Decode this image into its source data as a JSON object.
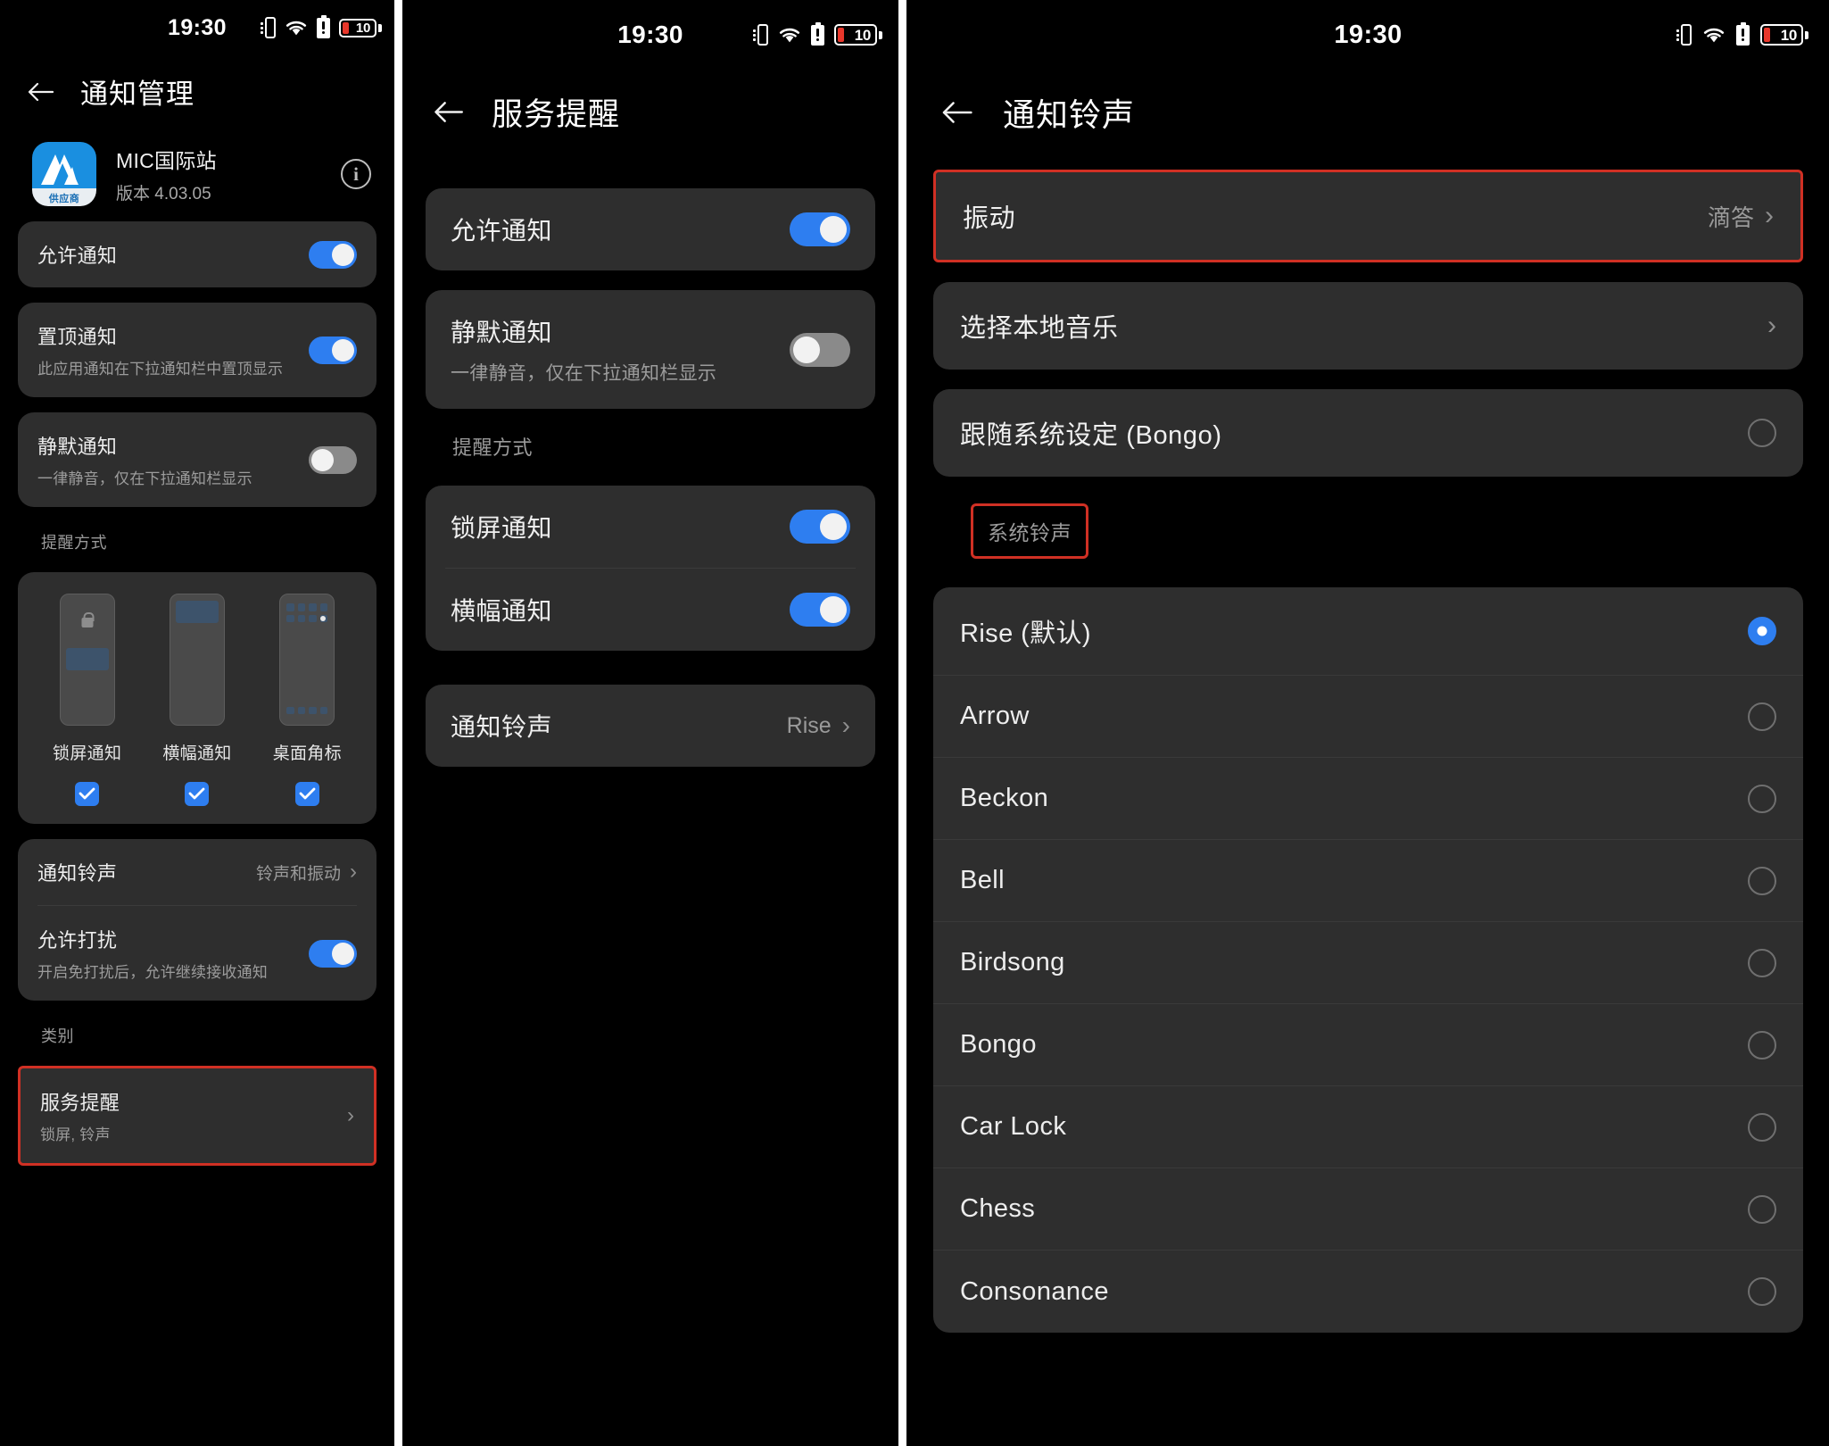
{
  "statusbar": {
    "time": "19:30",
    "battery_level": "10",
    "icons": [
      "vibrate-icon",
      "wifi-icon",
      "battery-alert-icon",
      "battery-icon"
    ]
  },
  "colors": {
    "accent_blue": "#2e7ef0",
    "card_bg": "#2e2e2e",
    "screen_bg": "#000000",
    "highlight_red": "#d03024",
    "battery_red": "#e8372b"
  },
  "panel1": {
    "title": "通知管理",
    "back_icon": "back-arrow-icon",
    "app": {
      "name": "MIC国际站",
      "version": "版本 4.03.05",
      "icon_badge": "供应商",
      "info_icon": "info-icon"
    },
    "rows": [
      {
        "title": "允许通知",
        "sub": "",
        "toggle": "on"
      },
      {
        "title": "置顶通知",
        "sub": "此应用通知在下拉通知栏中置顶显示",
        "toggle": "on"
      },
      {
        "title": "静默通知",
        "sub": "一律静音，仅在下拉通知栏显示",
        "toggle": "off"
      }
    ],
    "section_style_label": "提醒方式",
    "styles": [
      {
        "label": "锁屏通知",
        "checked": true,
        "preview": "lockscreen"
      },
      {
        "label": "横幅通知",
        "checked": true,
        "preview": "banner"
      },
      {
        "label": "桌面角标",
        "checked": true,
        "preview": "badge"
      }
    ],
    "ringtone_row": {
      "title": "通知铃声",
      "value": "铃声和振动"
    },
    "disturb_row": {
      "title": "允许打扰",
      "sub": "开启免打扰后，允许继续接收通知",
      "toggle": "on"
    },
    "section_category_label": "类别",
    "category_row": {
      "title": "服务提醒",
      "sub": "锁屏, 铃声",
      "highlighted": true
    }
  },
  "panel2": {
    "title": "服务提醒",
    "back_icon": "back-arrow-icon",
    "rows": [
      {
        "title": "允许通知",
        "sub": "",
        "toggle": "on"
      },
      {
        "title": "静默通知",
        "sub": "一律静音，仅在下拉通知栏显示",
        "toggle": "off"
      }
    ],
    "section_label": "提醒方式",
    "alert_rows": [
      {
        "title": "锁屏通知",
        "toggle": "on"
      },
      {
        "title": "横幅通知",
        "toggle": "on"
      }
    ],
    "ringtone_row": {
      "title": "通知铃声",
      "value": "Rise"
    }
  },
  "panel3": {
    "title": "通知铃声",
    "back_icon": "back-arrow-icon",
    "vibration_row": {
      "title": "振动",
      "value": "滴答",
      "highlighted": true
    },
    "local_music_row": {
      "title": "选择本地音乐"
    },
    "follow_system_row": {
      "title": "跟随系统设定 (Bongo)",
      "selected": false
    },
    "system_tones_label": "系统铃声",
    "system_tones_label_highlighted": true,
    "tones": [
      {
        "label": "Rise (默认)",
        "selected": true
      },
      {
        "label": "Arrow",
        "selected": false
      },
      {
        "label": "Beckon",
        "selected": false
      },
      {
        "label": "Bell",
        "selected": false
      },
      {
        "label": "Birdsong",
        "selected": false
      },
      {
        "label": "Bongo",
        "selected": false
      },
      {
        "label": "Car Lock",
        "selected": false
      },
      {
        "label": "Chess",
        "selected": false
      },
      {
        "label": "Consonance",
        "selected": false
      }
    ]
  }
}
